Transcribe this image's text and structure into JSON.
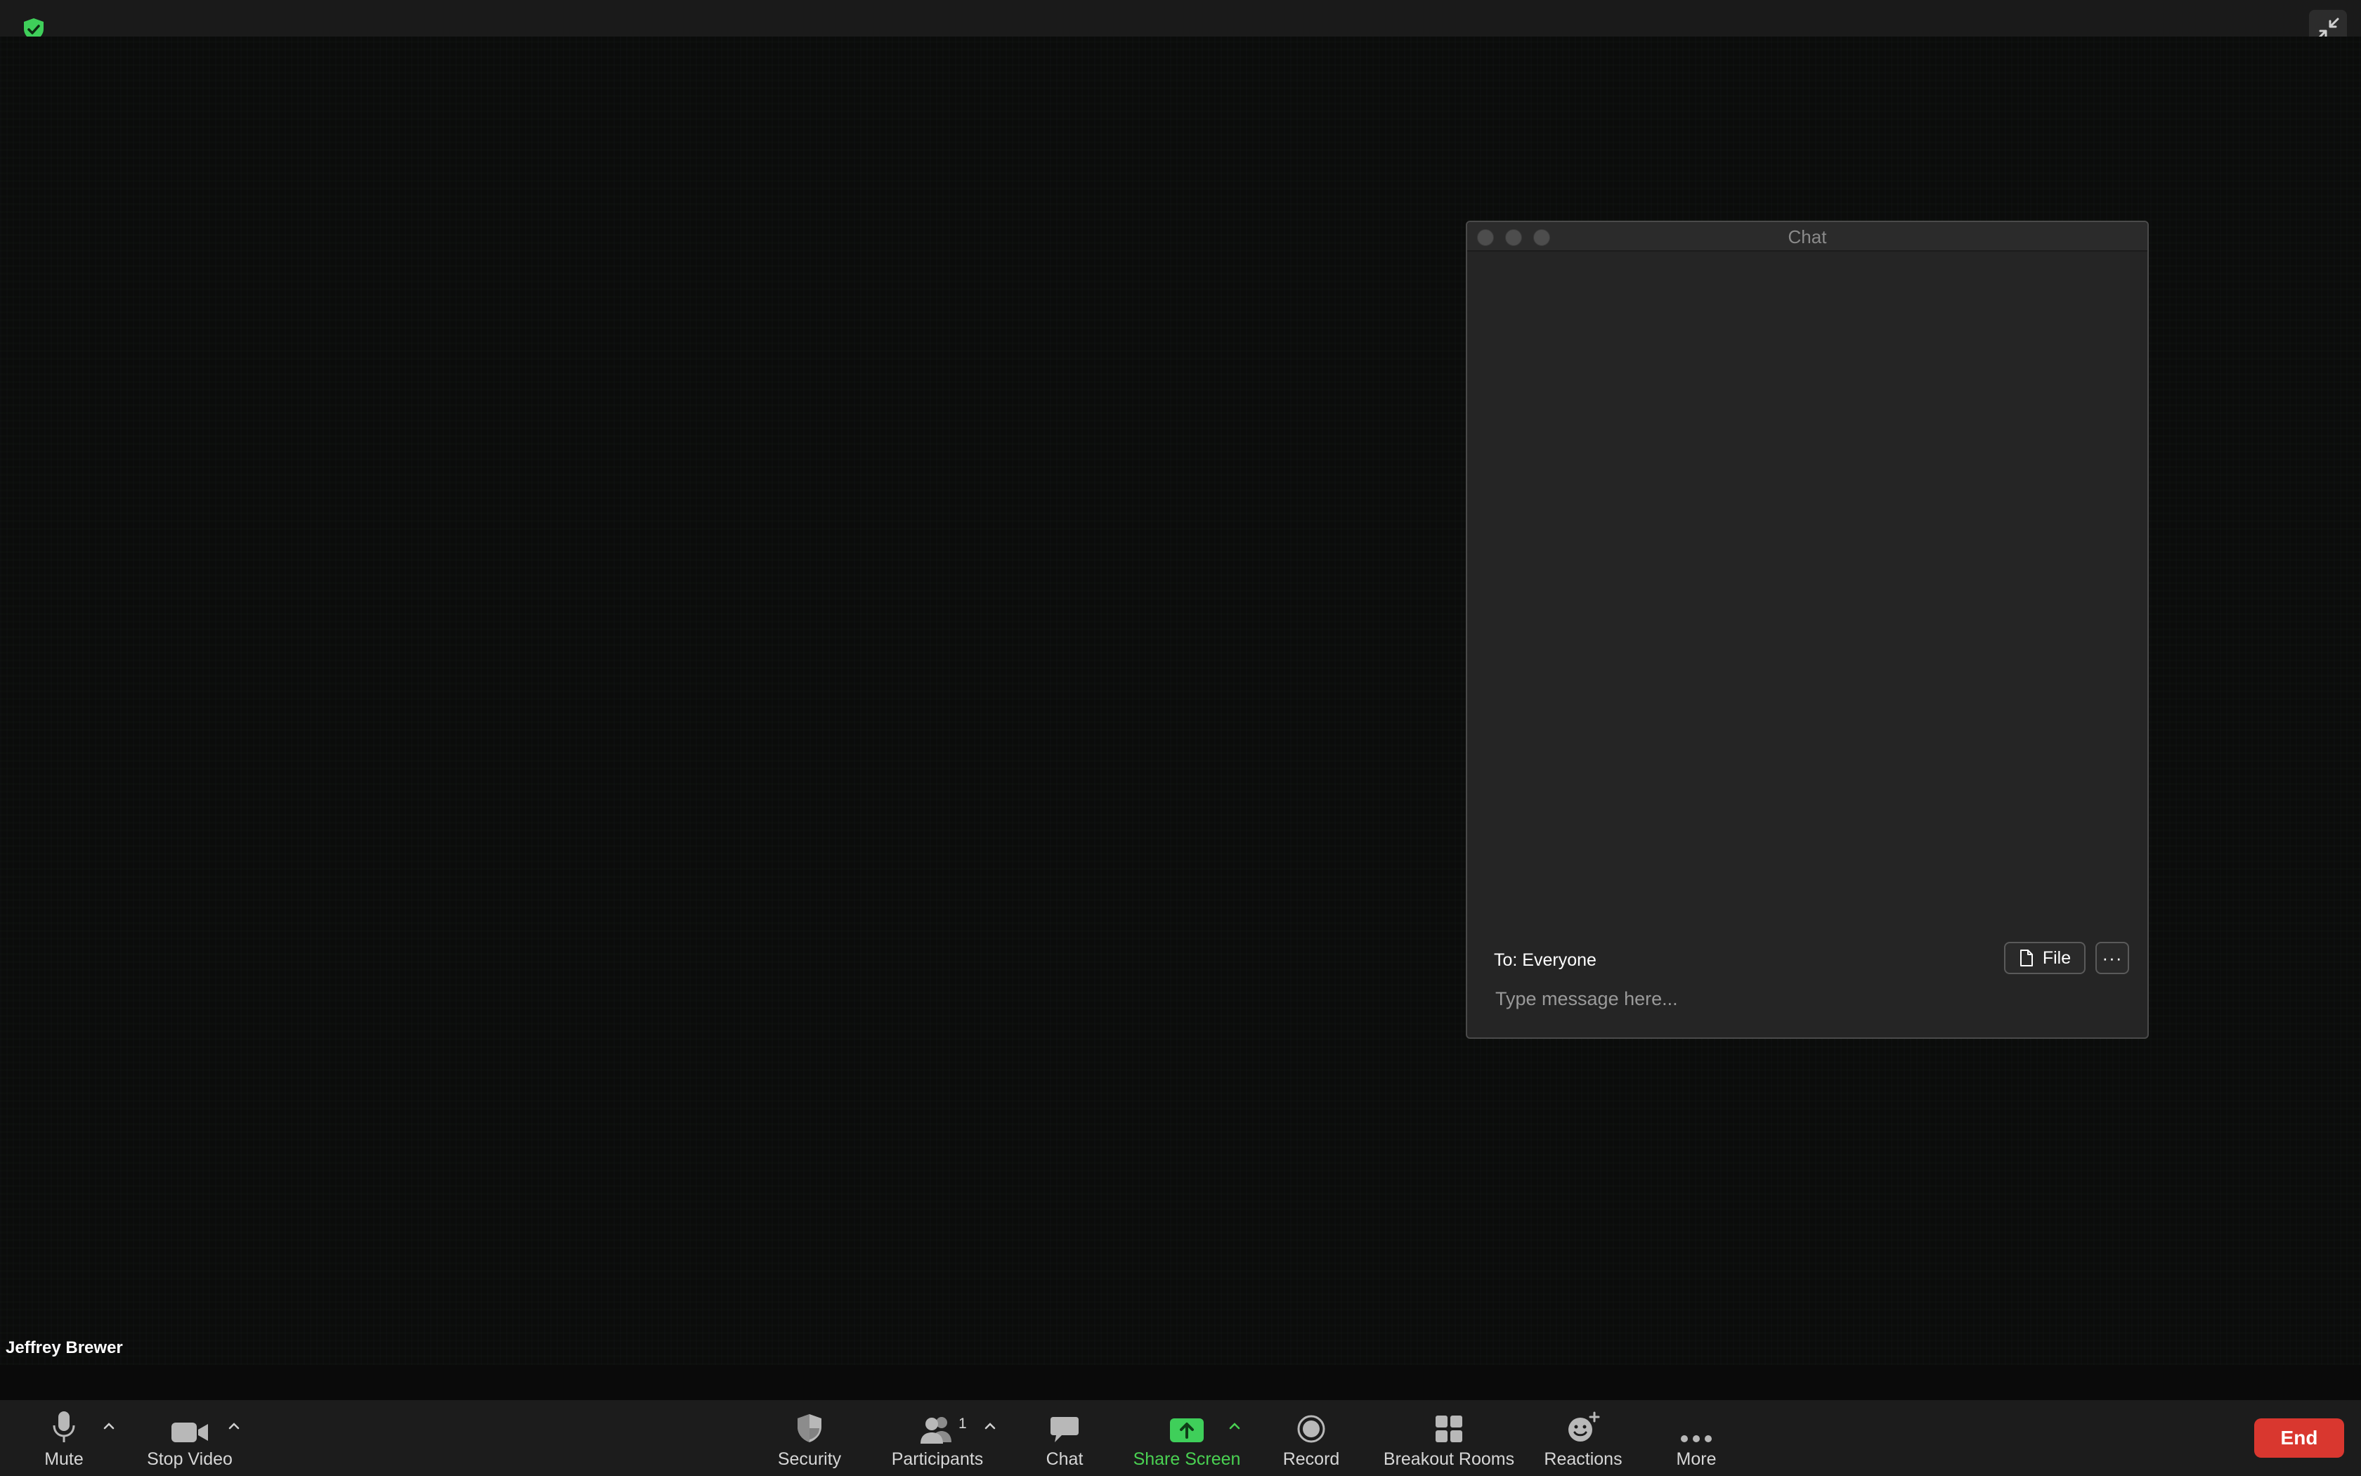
{
  "meeting": {
    "participant_name": "Jeffrey Brewer"
  },
  "icons": {
    "security_badge": "shield-check-icon",
    "exit_fullscreen": "exit-fullscreen-icon"
  },
  "colors": {
    "badge_green": "#3fcf5a",
    "share_green": "#4ad152",
    "end_red": "#d9372f"
  },
  "chat": {
    "title": "Chat",
    "recipient": "To: Everyone",
    "file_label": "File",
    "more_label": "···",
    "input_placeholder": "Type message here..."
  },
  "toolbar": {
    "mute_label": "Mute",
    "stop_video_label": "Stop Video",
    "security_label": "Security",
    "participants_label": "Participants",
    "participants_count": "1",
    "chat_label": "Chat",
    "share_screen_label": "Share Screen",
    "record_label": "Record",
    "breakout_rooms_label": "Breakout Rooms",
    "reactions_label": "Reactions",
    "more_label": "More",
    "end_label": "End"
  }
}
